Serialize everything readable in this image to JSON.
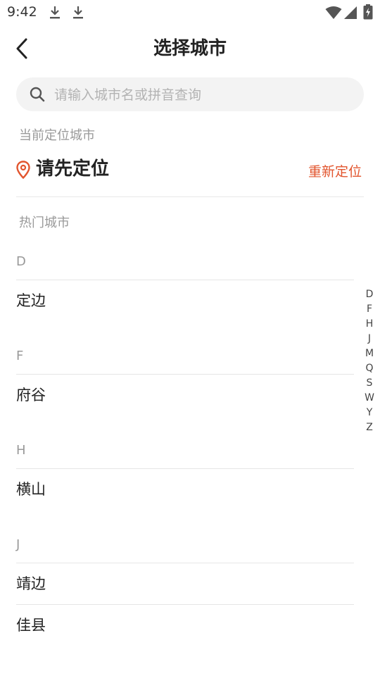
{
  "status_bar": {
    "time": "9:42",
    "icons": [
      "download-icon",
      "download-icon",
      "wifi-icon",
      "signal-icon",
      "battery-charging-icon"
    ]
  },
  "header": {
    "title": "选择城市",
    "back_icon": "chevron-left-icon"
  },
  "search": {
    "placeholder": "请输入城市名或拼音查询",
    "value": ""
  },
  "current_location": {
    "label": "当前定位城市",
    "value": "请先定位",
    "relocate_label": "重新定位",
    "icon": "location-pin-icon"
  },
  "hot_cities": {
    "label": "热门城市"
  },
  "city_groups": [
    {
      "letter": "D",
      "cities": [
        "定边"
      ]
    },
    {
      "letter": "F",
      "cities": [
        "府谷"
      ]
    },
    {
      "letter": "H",
      "cities": [
        "横山"
      ]
    },
    {
      "letter": "J",
      "cities": [
        "靖边",
        "佳县"
      ]
    }
  ],
  "index_letters": [
    "D",
    "F",
    "H",
    "J",
    "M",
    "Q",
    "S",
    "W",
    "Y",
    "Z"
  ],
  "colors": {
    "accent": "#e2552e",
    "muted_text": "#999999",
    "search_bg": "#f3f3f3"
  }
}
